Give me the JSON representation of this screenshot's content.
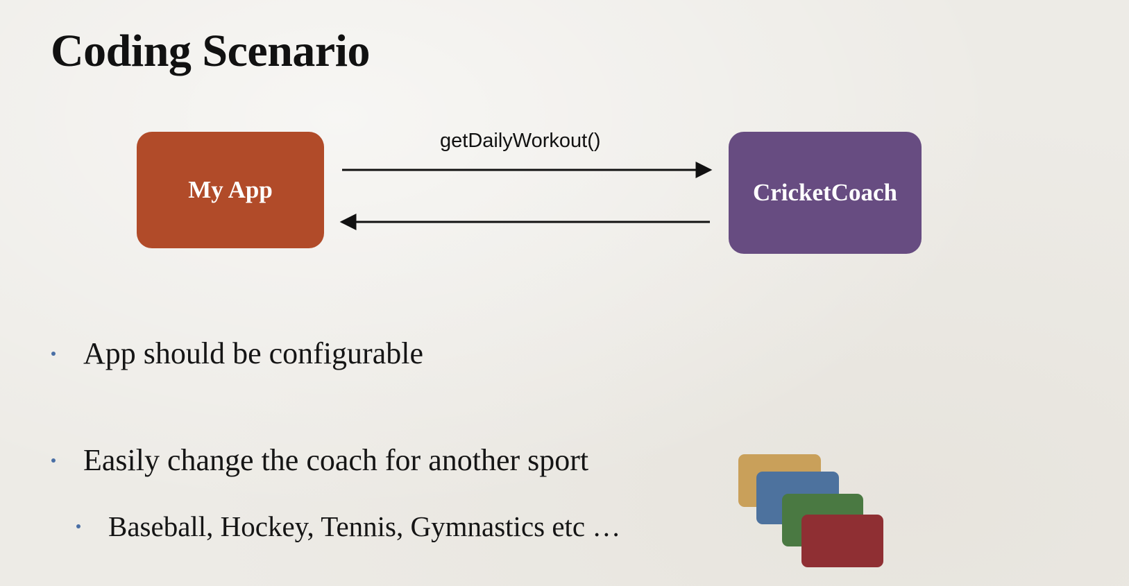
{
  "slide": {
    "title": "Coding Scenario"
  },
  "diagram": {
    "source_box": {
      "label": "My App",
      "color": "#b14b29"
    },
    "target_box": {
      "label": "CricketCoach",
      "color": "#674c81"
    },
    "request_label": "getDailyWorkout()"
  },
  "bullets": [
    {
      "text": "App should be configurable",
      "level": 1
    },
    {
      "text": "Easily change the coach for another sport",
      "level": 1
    },
    {
      "text": "Baseball, Hockey, Tennis, Gymnastics etc …",
      "level": 2
    }
  ],
  "colors": {
    "bullet_dot": "#4a6fa5",
    "cards": [
      "#c9a05a",
      "#4d729e",
      "#4a7942",
      "#8f2f33"
    ]
  }
}
